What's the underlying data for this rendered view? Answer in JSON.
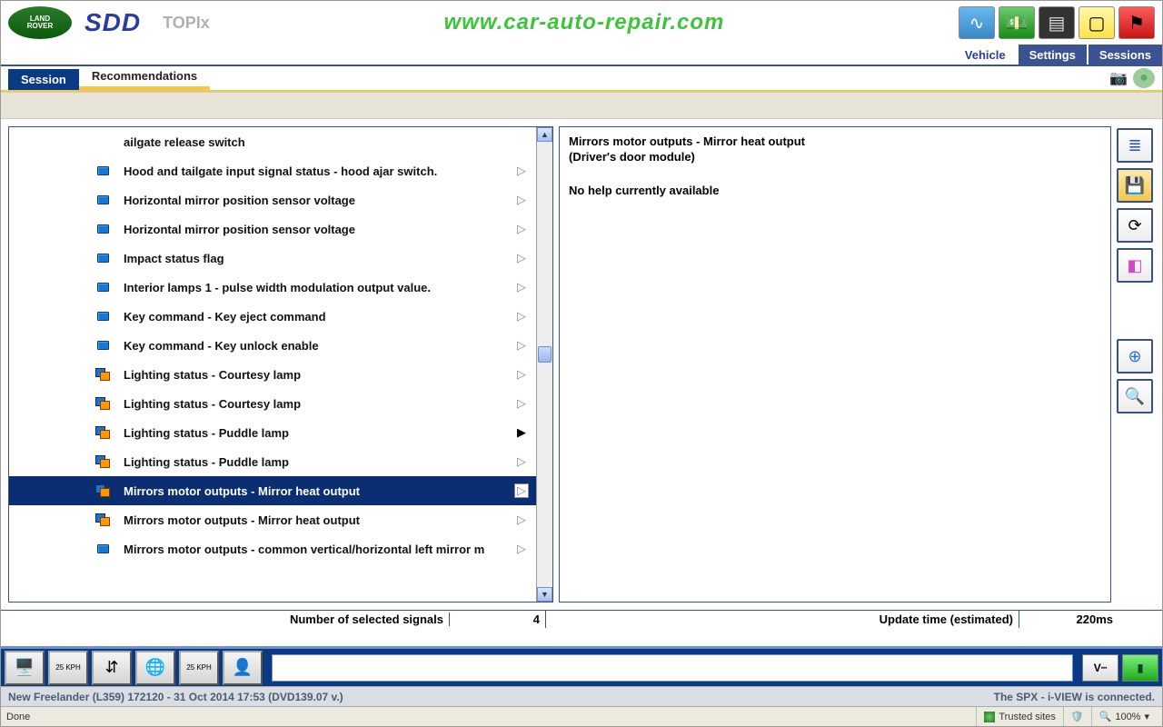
{
  "banner": {
    "logo_text": "LAND\nROVER",
    "sdd": "SDD",
    "topix": "TOPIx",
    "watermark": "www.car-auto-repair.com"
  },
  "topnav": {
    "vehicle": "Vehicle",
    "settings": "Settings",
    "sessions": "Sessions"
  },
  "tabs": {
    "session": "Session",
    "recommendations": "Recommendations"
  },
  "signals_first_partial": "ailgate release switch",
  "signals": [
    {
      "icon": "box",
      "label": "Hood and tailgate input signal status - hood ajar switch.",
      "exp": "empty"
    },
    {
      "icon": "box",
      "label": "Horizontal mirror position sensor voltage",
      "exp": "empty"
    },
    {
      "icon": "box",
      "label": "Horizontal mirror position sensor voltage",
      "exp": "empty"
    },
    {
      "icon": "box",
      "label": "Impact status flag",
      "exp": "empty"
    },
    {
      "icon": "box",
      "label": "Interior lamps 1 - pulse width modulation output value.",
      "exp": "empty"
    },
    {
      "icon": "box",
      "label": "Key command  -  Key eject command",
      "exp": "empty"
    },
    {
      "icon": "box",
      "label": "Key command  -  Key unlock enable",
      "exp": "empty"
    },
    {
      "icon": "multi",
      "label": "Lighting status  -  Courtesy lamp",
      "exp": "empty"
    },
    {
      "icon": "multi",
      "label": "Lighting status  -  Courtesy lamp",
      "exp": "empty"
    },
    {
      "icon": "multi",
      "label": "Lighting status  -  Puddle lamp",
      "exp": "filled"
    },
    {
      "icon": "multi",
      "label": "Lighting status  -  Puddle lamp",
      "exp": "empty"
    },
    {
      "icon": "multi",
      "label": "Mirrors motor outputs  -  Mirror heat output",
      "exp": "empty",
      "selected": true
    },
    {
      "icon": "multi",
      "label": "Mirrors motor outputs  -  Mirror heat output",
      "exp": "empty"
    },
    {
      "icon": "box",
      "label": "Mirrors motor outputs - common vertical/horizontal left mirror m",
      "exp": "empty"
    }
  ],
  "detail": {
    "line1": "Mirrors motor outputs  -  Mirror heat output",
    "line2": "(Driver's door module)",
    "help": "No help currently available"
  },
  "counts": {
    "selected_label": "Number of selected signals",
    "selected_value": "4",
    "update_label": "Update time (estimated)",
    "update_value": "220ms"
  },
  "status": {
    "left": "New Freelander (L359) 172120 - 31 Oct 2014 17:53 (DVD139.07 v.)",
    "right": "The SPX - i-VIEW is connected."
  },
  "ie": {
    "done": "Done",
    "trusted": "Trusted sites",
    "zoom": "100%"
  },
  "tools": {
    "list": "≣",
    "save": "💾",
    "refresh": "⟳",
    "erase": "◧",
    "add_view": "⊕",
    "inspect": "🔍"
  },
  "banner_icons": {
    "waveform": "∿",
    "money": "💵",
    "notepad": "▤",
    "sticky": "▢",
    "fire": "⚑"
  }
}
